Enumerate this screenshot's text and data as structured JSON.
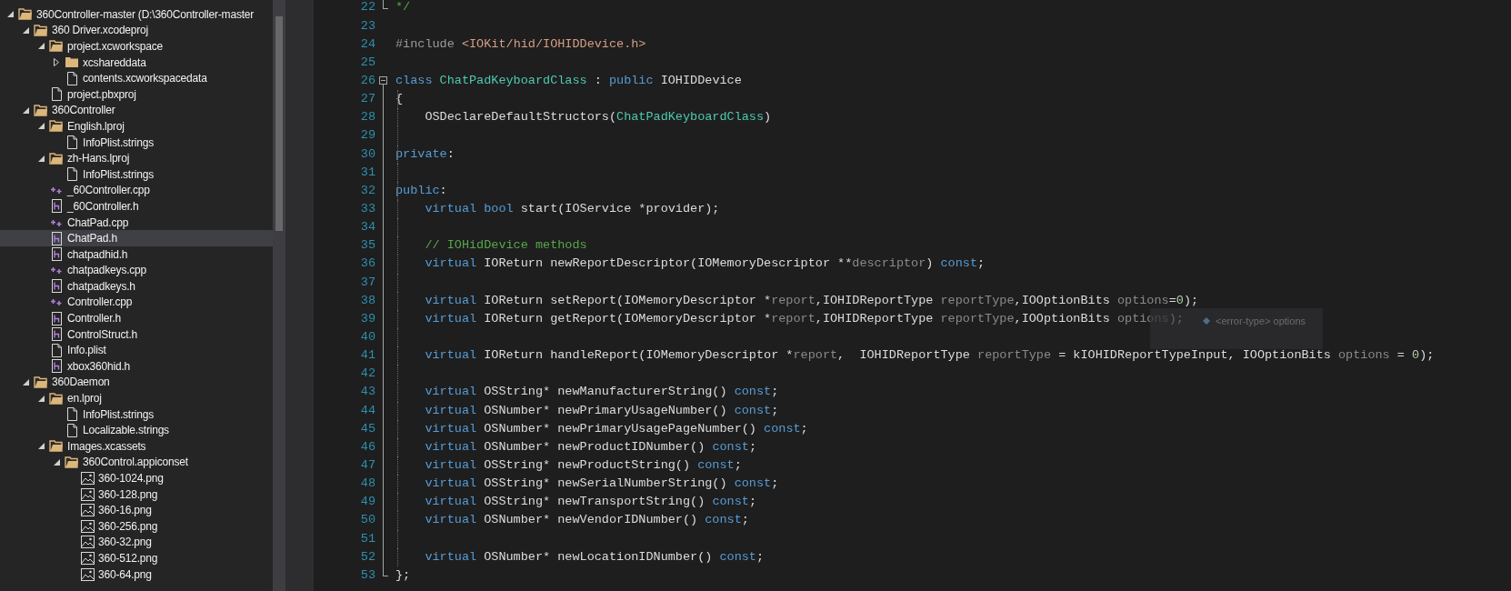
{
  "solution_explorer": {
    "items": [
      {
        "label": "360Controller-master (D:\\360Controller-master",
        "kind": "folder",
        "expanded": true,
        "selected": false,
        "children": [
          {
            "label": "360 Driver.xcodeproj",
            "kind": "folder",
            "expanded": true,
            "selected": false,
            "children": [
              {
                "label": "project.xcworkspace",
                "kind": "folder",
                "expanded": true,
                "selected": false,
                "children": [
                  {
                    "label": "xcshareddata",
                    "kind": "folder",
                    "expanded": false,
                    "selected": false
                  },
                  {
                    "label": "contents.xcworkspacedata",
                    "kind": "file",
                    "selected": false
                  }
                ]
              },
              {
                "label": "project.pbxproj",
                "kind": "file",
                "selected": false
              }
            ]
          },
          {
            "label": "360Controller",
            "kind": "folder",
            "expanded": true,
            "selected": false,
            "children": [
              {
                "label": "English.lproj",
                "kind": "folder",
                "expanded": true,
                "selected": false,
                "children": [
                  {
                    "label": "InfoPlist.strings",
                    "kind": "file",
                    "selected": false
                  }
                ]
              },
              {
                "label": "zh-Hans.lproj",
                "kind": "folder",
                "expanded": true,
                "selected": false,
                "children": [
                  {
                    "label": "InfoPlist.strings",
                    "kind": "file",
                    "selected": false
                  }
                ]
              },
              {
                "label": "_60Controller.cpp",
                "kind": "cpp",
                "selected": false
              },
              {
                "label": "_60Controller.h",
                "kind": "header",
                "selected": false
              },
              {
                "label": "ChatPad.cpp",
                "kind": "cpp",
                "selected": false
              },
              {
                "label": "ChatPad.h",
                "kind": "header",
                "selected": true
              },
              {
                "label": "chatpadhid.h",
                "kind": "header",
                "selected": false
              },
              {
                "label": "chatpadkeys.cpp",
                "kind": "cpp",
                "selected": false
              },
              {
                "label": "chatpadkeys.h",
                "kind": "header",
                "selected": false
              },
              {
                "label": "Controller.cpp",
                "kind": "cpp",
                "selected": false
              },
              {
                "label": "Controller.h",
                "kind": "header",
                "selected": false
              },
              {
                "label": "ControlStruct.h",
                "kind": "header",
                "selected": false
              },
              {
                "label": "Info.plist",
                "kind": "file",
                "selected": false
              },
              {
                "label": "xbox360hid.h",
                "kind": "header",
                "selected": false
              }
            ]
          },
          {
            "label": "360Daemon",
            "kind": "folder",
            "expanded": true,
            "selected": false,
            "children": [
              {
                "label": "en.lproj",
                "kind": "folder",
                "expanded": true,
                "selected": false,
                "children": [
                  {
                    "label": "InfoPlist.strings",
                    "kind": "file",
                    "selected": false
                  },
                  {
                    "label": "Localizable.strings",
                    "kind": "file",
                    "selected": false
                  }
                ]
              },
              {
                "label": "Images.xcassets",
                "kind": "folder",
                "expanded": true,
                "selected": false,
                "children": [
                  {
                    "label": "360Control.appiconset",
                    "kind": "folder",
                    "expanded": true,
                    "selected": false,
                    "children": [
                      {
                        "label": "360-1024.png",
                        "kind": "image",
                        "selected": false
                      },
                      {
                        "label": "360-128.png",
                        "kind": "image",
                        "selected": false
                      },
                      {
                        "label": "360-16.png",
                        "kind": "image",
                        "selected": false
                      },
                      {
                        "label": "360-256.png",
                        "kind": "image",
                        "selected": false
                      },
                      {
                        "label": "360-32.png",
                        "kind": "image",
                        "selected": false
                      },
                      {
                        "label": "360-512.png",
                        "kind": "image",
                        "selected": false
                      },
                      {
                        "label": "360-64.png",
                        "kind": "image",
                        "selected": false
                      }
                    ]
                  }
                ]
              }
            ]
          }
        ]
      }
    ]
  },
  "editor": {
    "lines": [
      {
        "number": "22",
        "kind": "end",
        "tokens": [
          {
            "kind": "comment",
            "text": "*/"
          }
        ]
      },
      {
        "number": "23"
      },
      {
        "number": "24",
        "tokens": [
          {
            "kind": "preprocessor",
            "text": "#include "
          },
          {
            "kind": "string",
            "text": "<IOKit/hid/IOHIDDevice.h>"
          }
        ]
      },
      {
        "number": "25"
      },
      {
        "number": "26",
        "kind": "start",
        "tokens": [
          {
            "kind": "keyword",
            "text": "class "
          },
          {
            "kind": "type",
            "text": "ChatPadKeyboardClass"
          },
          {
            "kind": "plain",
            "text": " : "
          },
          {
            "kind": "keyword",
            "text": "public "
          },
          {
            "kind": "plain",
            "text": "IOHIDDevice"
          }
        ]
      },
      {
        "number": "27",
        "kind": "body",
        "tokens": [
          {
            "kind": "plain",
            "text": "{"
          }
        ]
      },
      {
        "number": "28",
        "kind": "body",
        "tokens": [
          {
            "kind": "plain",
            "text": "    OSDeclareDefaultStructors("
          },
          {
            "kind": "type",
            "text": "ChatPadKeyboardClass"
          },
          {
            "kind": "plain",
            "text": ")"
          }
        ]
      },
      {
        "number": "29",
        "kind": "body"
      },
      {
        "number": "30",
        "kind": "body",
        "tokens": [
          {
            "kind": "keyword",
            "text": "private"
          },
          {
            "kind": "plain",
            "text": ":"
          }
        ]
      },
      {
        "number": "31",
        "kind": "body"
      },
      {
        "number": "32",
        "kind": "body",
        "tokens": [
          {
            "kind": "keyword",
            "text": "public"
          },
          {
            "kind": "plain",
            "text": ":"
          }
        ]
      },
      {
        "number": "33",
        "kind": "body",
        "tokens": [
          {
            "kind": "keyword",
            "text": "    virtual bool "
          },
          {
            "kind": "plain",
            "text": "start(IOService *provider);"
          }
        ]
      },
      {
        "number": "34",
        "kind": "body"
      },
      {
        "number": "35",
        "kind": "body",
        "tokens": [
          {
            "kind": "comment",
            "text": "    // IOHidDevice methods"
          }
        ]
      },
      {
        "number": "36",
        "kind": "body",
        "tokens": [
          {
            "kind": "keyword",
            "text": "    virtual "
          },
          {
            "kind": "plain",
            "text": "IOReturn newReportDescriptor(IOMemoryDescriptor **"
          },
          {
            "kind": "parameter",
            "text": "descriptor"
          },
          {
            "kind": "plain",
            "text": ") "
          },
          {
            "kind": "keyword",
            "text": "const"
          },
          {
            "kind": "plain",
            "text": ";"
          }
        ]
      },
      {
        "number": "37",
        "kind": "body"
      },
      {
        "number": "38",
        "kind": "body",
        "tokens": [
          {
            "kind": "keyword",
            "text": "    virtual "
          },
          {
            "kind": "plain",
            "text": "IOReturn setReport(IOMemoryDescriptor *"
          },
          {
            "kind": "parameter",
            "text": "report"
          },
          {
            "kind": "plain",
            "text": ",IOHIDReportType "
          },
          {
            "kind": "parameter",
            "text": "reportType"
          },
          {
            "kind": "plain",
            "text": ",IOOptionBits "
          },
          {
            "kind": "parameter",
            "text": "options"
          },
          {
            "kind": "plain",
            "text": "="
          },
          {
            "kind": "number",
            "text": "0"
          },
          {
            "kind": "plain",
            "text": ");"
          }
        ]
      },
      {
        "number": "39",
        "kind": "body",
        "tokens": [
          {
            "kind": "keyword",
            "text": "    virtual "
          },
          {
            "kind": "plain",
            "text": "IOReturn getReport(IOMemoryDescriptor *"
          },
          {
            "kind": "parameter",
            "text": "report"
          },
          {
            "kind": "plain",
            "text": ",IOHIDReportType "
          },
          {
            "kind": "parameter",
            "text": "reportType"
          },
          {
            "kind": "plain",
            "text": ",IOOptionBits "
          },
          {
            "kind": "parameter",
            "text": "options"
          },
          {
            "kind": "plain",
            "text": ");"
          }
        ]
      },
      {
        "number": "40",
        "kind": "body"
      },
      {
        "number": "41",
        "kind": "body",
        "tokens": [
          {
            "kind": "keyword",
            "text": "    virtual "
          },
          {
            "kind": "plain",
            "text": "IOReturn handleReport(IOMemoryDescriptor *"
          },
          {
            "kind": "parameter",
            "text": "report"
          },
          {
            "kind": "plain",
            "text": ",  IOHIDReportType "
          },
          {
            "kind": "parameter",
            "text": "reportType"
          },
          {
            "kind": "plain",
            "text": " = kIOHIDReportTypeInput, IOOptionBits "
          },
          {
            "kind": "parameter",
            "text": "options"
          },
          {
            "kind": "plain",
            "text": " = "
          },
          {
            "kind": "number",
            "text": "0"
          },
          {
            "kind": "plain",
            "text": ");"
          }
        ]
      },
      {
        "number": "42",
        "kind": "body"
      },
      {
        "number": "43",
        "kind": "body",
        "tokens": [
          {
            "kind": "keyword",
            "text": "    virtual "
          },
          {
            "kind": "plain",
            "text": "OSString* newManufacturerString() "
          },
          {
            "kind": "keyword",
            "text": "const"
          },
          {
            "kind": "plain",
            "text": ";"
          }
        ]
      },
      {
        "number": "44",
        "kind": "body",
        "tokens": [
          {
            "kind": "keyword",
            "text": "    virtual "
          },
          {
            "kind": "plain",
            "text": "OSNumber* newPrimaryUsageNumber() "
          },
          {
            "kind": "keyword",
            "text": "const"
          },
          {
            "kind": "plain",
            "text": ";"
          }
        ]
      },
      {
        "number": "45",
        "kind": "body",
        "tokens": [
          {
            "kind": "keyword",
            "text": "    virtual "
          },
          {
            "kind": "plain",
            "text": "OSNumber* newPrimaryUsagePageNumber() "
          },
          {
            "kind": "keyword",
            "text": "const"
          },
          {
            "kind": "plain",
            "text": ";"
          }
        ]
      },
      {
        "number": "46",
        "kind": "body",
        "tokens": [
          {
            "kind": "keyword",
            "text": "    virtual "
          },
          {
            "kind": "plain",
            "text": "OSNumber* newProductIDNumber() "
          },
          {
            "kind": "keyword",
            "text": "const"
          },
          {
            "kind": "plain",
            "text": ";"
          }
        ]
      },
      {
        "number": "47",
        "kind": "body",
        "tokens": [
          {
            "kind": "keyword",
            "text": "    virtual "
          },
          {
            "kind": "plain",
            "text": "OSString* newProductString() "
          },
          {
            "kind": "keyword",
            "text": "const"
          },
          {
            "kind": "plain",
            "text": ";"
          }
        ]
      },
      {
        "number": "48",
        "kind": "body",
        "tokens": [
          {
            "kind": "keyword",
            "text": "    virtual "
          },
          {
            "kind": "plain",
            "text": "OSString* newSerialNumberString() "
          },
          {
            "kind": "keyword",
            "text": "const"
          },
          {
            "kind": "plain",
            "text": ";"
          }
        ]
      },
      {
        "number": "49",
        "kind": "body",
        "tokens": [
          {
            "kind": "keyword",
            "text": "    virtual "
          },
          {
            "kind": "plain",
            "text": "OSString* newTransportString() "
          },
          {
            "kind": "keyword",
            "text": "const"
          },
          {
            "kind": "plain",
            "text": ";"
          }
        ]
      },
      {
        "number": "50",
        "kind": "body",
        "tokens": [
          {
            "kind": "keyword",
            "text": "    virtual "
          },
          {
            "kind": "plain",
            "text": "OSNumber* newVendorIDNumber() "
          },
          {
            "kind": "keyword",
            "text": "const"
          },
          {
            "kind": "plain",
            "text": ";"
          }
        ]
      },
      {
        "number": "51",
        "kind": "body"
      },
      {
        "number": "52",
        "kind": "body",
        "tokens": [
          {
            "kind": "keyword",
            "text": "    virtual "
          },
          {
            "kind": "plain",
            "text": "OSNumber* newLocationIDNumber() "
          },
          {
            "kind": "keyword",
            "text": "const"
          },
          {
            "kind": "plain",
            "text": ";"
          }
        ]
      },
      {
        "number": "53",
        "kind": "end",
        "tokens": [
          {
            "kind": "plain",
            "text": "};"
          }
        ]
      }
    ],
    "tooltip": {
      "text": "<error-type> options"
    }
  }
}
